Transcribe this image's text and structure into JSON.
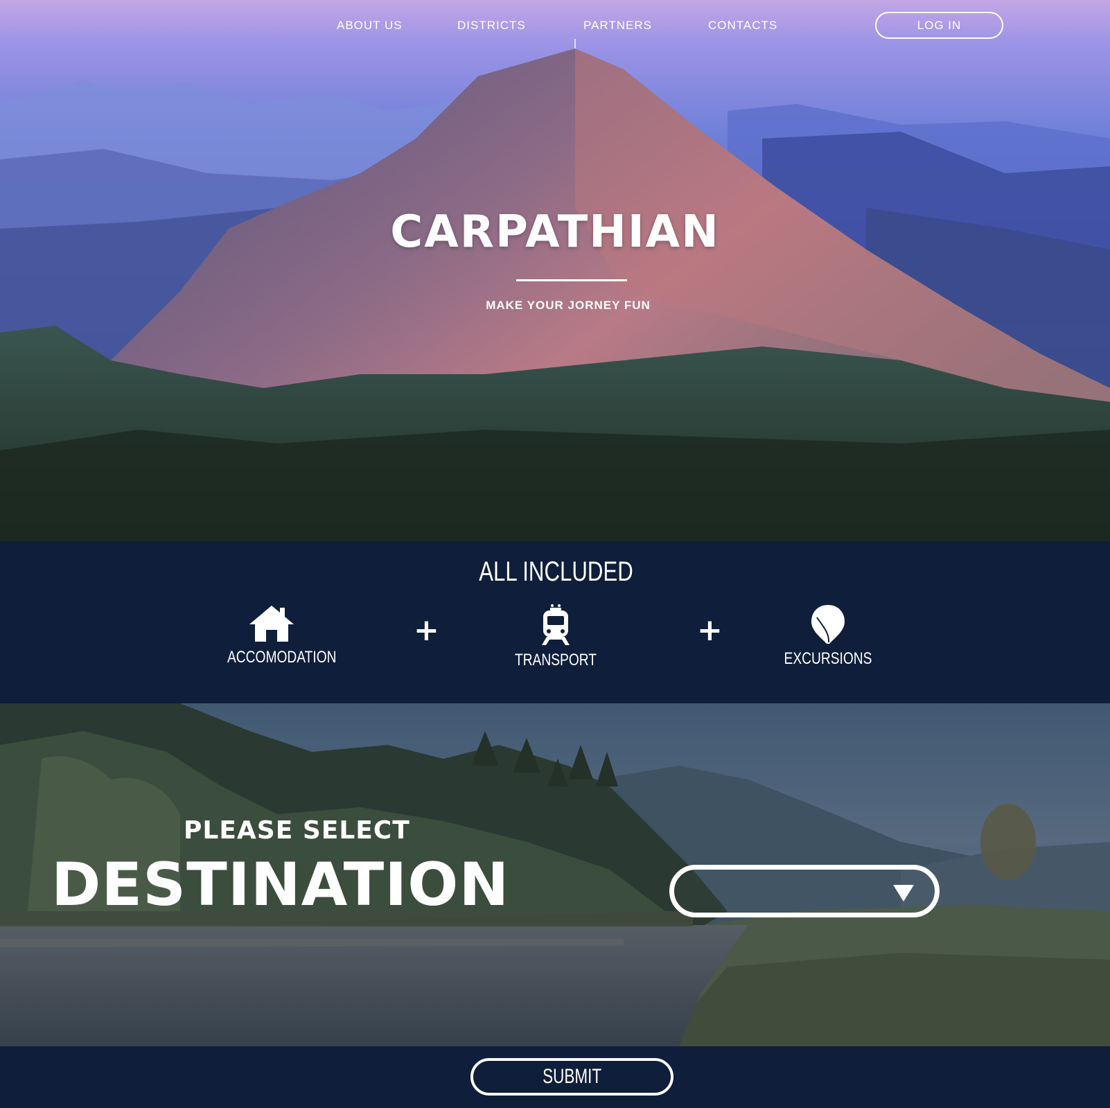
{
  "nav": {
    "items": [
      {
        "label": "ABOUT US"
      },
      {
        "label": "DISTRICTS"
      },
      {
        "label": "PARTNERS"
      },
      {
        "label": "CONTACTS"
      }
    ],
    "login_label": "LOG IN"
  },
  "hero": {
    "title": "CARPATHIAN",
    "subtitle": "MAKE YOUR JORNEY FUN"
  },
  "included": {
    "title": "ALL INCLUDED",
    "features": [
      {
        "label": "ACCOMODATION",
        "icon": "house-icon"
      },
      {
        "label": "TRANSPORT",
        "icon": "train-icon"
      },
      {
        "label": "EXCURSIONS",
        "icon": "balloon-icon"
      }
    ],
    "separator": "+"
  },
  "destination": {
    "kicker": "PLEASE SELECT",
    "title": "DESTINATION",
    "selected_value": "",
    "caret_icon": "chevron-down-icon"
  },
  "submit": {
    "label": "SUBMIT"
  },
  "colors": {
    "navy": "#0f1e3a",
    "white": "#ffffff"
  }
}
